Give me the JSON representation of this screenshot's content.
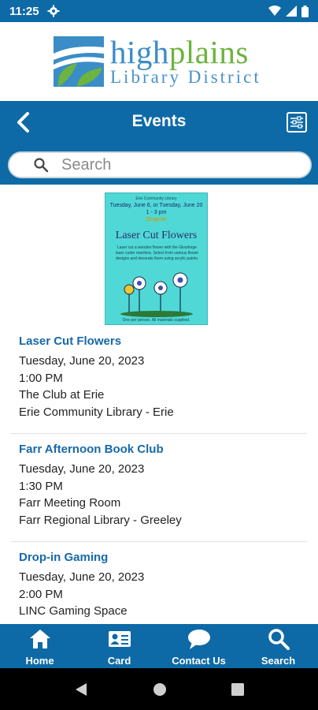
{
  "status_bar": {
    "time": "11:25"
  },
  "logo": {
    "word_high": "high",
    "word_plains": "plains",
    "subtitle": "Library District"
  },
  "header": {
    "title": "Events"
  },
  "search": {
    "placeholder": "Search"
  },
  "flyer": {
    "top_text": "Erie Community Library",
    "date_line1": "Tuesday, June 6, or Tuesday, June 20",
    "date_line2": "1 - 3 pm",
    "date_line3": "Drop-in",
    "title": "Laser Cut Flowers",
    "body": "Laser cut a wooden flower with the Glowforge laser cutter machine. Select from various flower designs and decorate them using acrylic paints.",
    "footer": "One per person. All materials supplied."
  },
  "events": [
    {
      "title": "Laser Cut Flowers",
      "date": "Tuesday, June 20, 2023",
      "time": "1:00 PM",
      "room": "The Club at Erie",
      "library": "Erie Community Library - Erie"
    },
    {
      "title": "Farr Afternoon Book Club",
      "date": "Tuesday, June 20, 2023",
      "time": "1:30 PM",
      "room": "Farr Meeting Room",
      "library": "Farr Regional Library - Greeley"
    },
    {
      "title": "Drop-in Gaming",
      "date": "Tuesday, June 20, 2023",
      "time": "2:00 PM",
      "room": "LINC Gaming Space",
      "library": ""
    }
  ],
  "bottom_nav": [
    {
      "label": "Home",
      "icon": "home-icon"
    },
    {
      "label": "Card",
      "icon": "card-icon"
    },
    {
      "label": "Contact Us",
      "icon": "chat-icon"
    },
    {
      "label": "Search",
      "icon": "search-icon"
    }
  ],
  "colors": {
    "brand_blue": "#0e6aa6",
    "link_blue": "#1769a8",
    "logo_green": "#6db33f"
  }
}
